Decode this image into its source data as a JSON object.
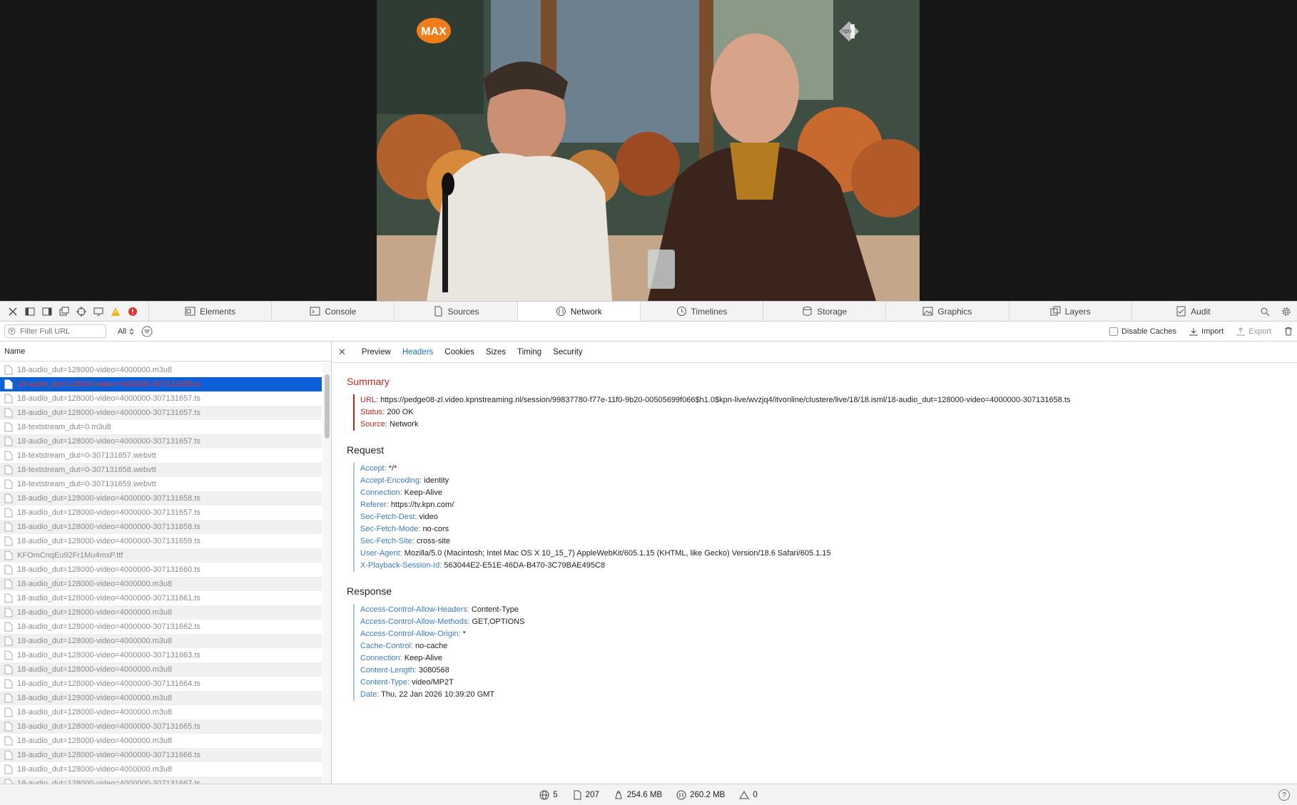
{
  "video": {
    "channel_logo_text": "MAX",
    "broadcaster_logo_text": "npo"
  },
  "toolbar": {
    "tabs": [
      {
        "label": "Elements",
        "icon": "elements-icon"
      },
      {
        "label": "Console",
        "icon": "console-icon"
      },
      {
        "label": "Sources",
        "icon": "sources-icon"
      },
      {
        "label": "Network",
        "icon": "network-icon",
        "active": true
      },
      {
        "label": "Timelines",
        "icon": "timelines-icon"
      },
      {
        "label": "Storage",
        "icon": "storage-icon"
      },
      {
        "label": "Graphics",
        "icon": "graphics-icon"
      },
      {
        "label": "Layers",
        "icon": "layers-icon"
      },
      {
        "label": "Audit",
        "icon": "audit-icon"
      }
    ],
    "warning_color": "#f5b400",
    "error_color": "#e0332e"
  },
  "filter": {
    "placeholder": "Filter Full URL",
    "type_value": "All",
    "disable_caches_label": "Disable Caches",
    "import_label": "Import",
    "export_label": "Export"
  },
  "list": {
    "header": "Name",
    "selected_index": 1,
    "rows": [
      "18-audio_dut=128000-video=4000000.m3u8",
      "18-audio_dut=128000-video=4000000-307131658.ts",
      "18-audio_dut=128000-video=4000000-307131657.ts",
      "18-audio_dut=128000-video=4000000-307131657.ts",
      "18-textstream_dut=0.m3u8",
      "18-audio_dut=128000-video=4000000-307131657.ts",
      "18-textstream_dut=0-307131657.webvtt",
      "18-textstream_dut=0-307131658.webvtt",
      "18-textstream_dut=0-307131659.webvtt",
      "18-audio_dut=128000-video=4000000-307131658.ts",
      "18-audio_dut=128000-video=4000000-307131657.ts",
      "18-audio_dut=128000-video=4000000-307131658.ts",
      "18-audio_dut=128000-video=4000000-307131659.ts",
      "KFOmCnqEu92Fr1Mu4mxP.ttf",
      "18-audio_dut=128000-video=4000000-307131660.ts",
      "18-audio_dut=128000-video=4000000.m3u8",
      "18-audio_dut=128000-video=4000000-307131661.ts",
      "18-audio_dut=128000-video=4000000.m3u8",
      "18-audio_dut=128000-video=4000000-307131662.ts",
      "18-audio_dut=128000-video=4000000.m3u8",
      "18-audio_dut=128000-video=4000000-307131663.ts",
      "18-audio_dut=128000-video=4000000.m3u8",
      "18-audio_dut=128000-video=4000000-307131664.ts",
      "18-audio_dut=128000-video=4000000.m3u8",
      "18-audio_dut=128000-video=4000000.m3u8",
      "18-audio_dut=128000-video=4000000-307131665.ts",
      "18-audio_dut=128000-video=4000000.m3u8",
      "18-audio_dut=128000-video=4000000-307131666.ts",
      "18-audio_dut=128000-video=4000000.m3u8",
      "18-audio_dut=128000-video=4000000-307131667.ts"
    ]
  },
  "detail": {
    "subtabs": [
      "Preview",
      "Headers",
      "Cookies",
      "Sizes",
      "Timing",
      "Security"
    ],
    "active_subtab": "Headers",
    "summary_title": "Summary",
    "summary": [
      {
        "k": "URL:",
        "v": "https://pedge08-zl.video.kpnstreaming.nl/session/99837780-f77e-11f0-9b20-00505699f066$h1.0$kpn-live/wvzjq4/itvonline/clustere/live/18/18.isml/18-audio_dut=128000-video=4000000-307131658.ts"
      },
      {
        "k": "Status:",
        "v": "200 OK"
      },
      {
        "k": "Source:",
        "v": "Network"
      }
    ],
    "request_title": "Request",
    "request": [
      {
        "k": "Accept:",
        "v": "*/*"
      },
      {
        "k": "Accept-Encoding:",
        "v": "identity"
      },
      {
        "k": "Connection:",
        "v": "Keep-Alive"
      },
      {
        "k": "Referer:",
        "v": "https://tv.kpn.com/"
      },
      {
        "k": "Sec-Fetch-Dest:",
        "v": "video"
      },
      {
        "k": "Sec-Fetch-Mode:",
        "v": "no-cors"
      },
      {
        "k": "Sec-Fetch-Site:",
        "v": "cross-site"
      },
      {
        "k": "User-Agent:",
        "v": "Mozilla/5.0 (Macintosh; Intel Mac OS X 10_15_7) AppleWebKit/605.1.15 (KHTML, like Gecko) Version/18.6 Safari/605.1.15"
      },
      {
        "k": "X-Playback-Session-Id:",
        "v": "563044E2-E51E-46DA-B470-3C79BAE495C8"
      }
    ],
    "response_title": "Response",
    "response": [
      {
        "k": "Access-Control-Allow-Headers:",
        "v": "Content-Type"
      },
      {
        "k": "Access-Control-Allow-Methods:",
        "v": "GET,OPTIONS"
      },
      {
        "k": "Access-Control-Allow-Origin:",
        "v": "*"
      },
      {
        "k": "Cache-Control:",
        "v": "no-cache"
      },
      {
        "k": "Connection:",
        "v": "Keep-Alive"
      },
      {
        "k": "Content-Length:",
        "v": "3080568"
      },
      {
        "k": "Content-Type:",
        "v": "video/MP2T"
      },
      {
        "k": "Date:",
        "v": "Thu, 22 Jan 2026 10:39:20 GMT"
      }
    ]
  },
  "status": {
    "domains": "5",
    "requests": "207",
    "transferred": "254.6 MB",
    "resources": "260.2 MB",
    "errors": "0",
    "help": "?"
  }
}
